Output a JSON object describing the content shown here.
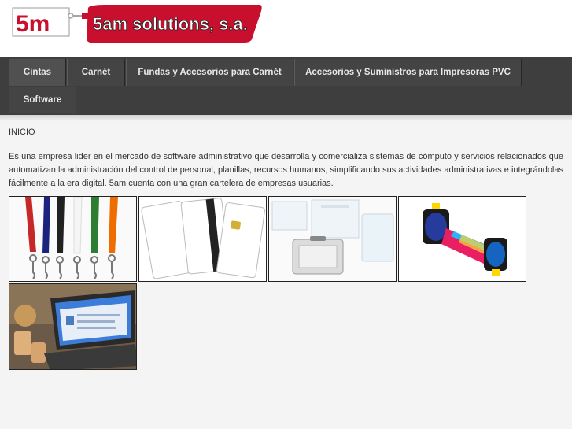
{
  "header": {
    "logo_text": "5m",
    "brand_name": "5am solutions, s.a."
  },
  "nav": {
    "items": [
      {
        "label": "Cintas"
      },
      {
        "label": "Carnét"
      },
      {
        "label": "Fundas y Accesorios para Carnét"
      },
      {
        "label": "Accesorios y Suministros para Impresoras PVC"
      },
      {
        "label": "Software"
      }
    ]
  },
  "content": {
    "breadcrumb": "INICIO",
    "description": "Es una empresa lider en el mercado de software administrativo que desarrolla y comercializa sistemas de cómputo y servicios relacionados que automatizan la administración del control de personal, planillas, recursos humanos, simplificando sus actividades administrativas e integrándolas fácilmente a la era digital. 5am cuenta con una gran cartelera de empresas usuarias."
  },
  "colors": {
    "brand_red": "#c8102e",
    "nav_bg": "#3e3e3e",
    "page_bg": "#f4f4f4"
  }
}
